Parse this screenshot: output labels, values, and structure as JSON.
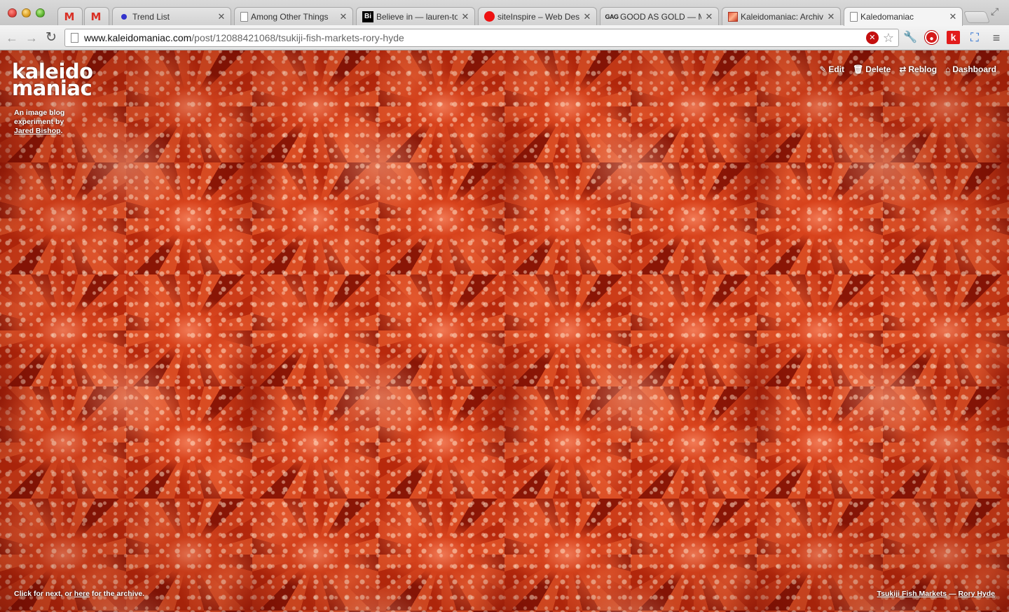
{
  "browser": {
    "tabs": [
      {
        "favicon": "gmail-icon",
        "title": "M",
        "active": false
      },
      {
        "favicon": "gmail-icon",
        "title": "M",
        "active": false
      },
      {
        "favicon": "dot-icon",
        "title": "Trend List",
        "active": false
      },
      {
        "favicon": "page-icon",
        "title": "Among Other Things",
        "active": false
      },
      {
        "favicon": "bi-icon",
        "title": "Believe in — lauren-to",
        "active": false
      },
      {
        "favicon": "siteinspire-icon",
        "title": "siteInspire – Web Desi",
        "active": false
      },
      {
        "favicon": "gag-icon",
        "title": "GOOD AS GOLD — ME",
        "active": false
      },
      {
        "favicon": "kaleido-icon",
        "title": "Kaleidomaniac: Archive",
        "active": false
      },
      {
        "favicon": "page-icon",
        "title": "Kaledomaniac",
        "active": true
      }
    ],
    "url_host": "www.kaleidomaniac.com",
    "url_path": "/post/12088421068/tsukiji-fish-markets-rory-hyde"
  },
  "site": {
    "logo_line1": "kaleido",
    "logo_line2": "maniac",
    "tagline_prefix": "An image blog experiment by",
    "tagline_author": "Jared Bishop",
    "tagline_suffix": "."
  },
  "controls": {
    "edit": "Edit",
    "delete": "Delete",
    "reblog": "Reblog",
    "dashboard": "Dashboard"
  },
  "footer": {
    "left_prefix": "Click for next, or",
    "left_link": "here",
    "left_suffix": "for the archive.",
    "right_title": "Tsukiji Fish Markets",
    "right_sep": "—",
    "right_author": "Rory Hyde"
  },
  "colors": {
    "accent": "#d8431c",
    "chrome": "#e2e2e2"
  }
}
